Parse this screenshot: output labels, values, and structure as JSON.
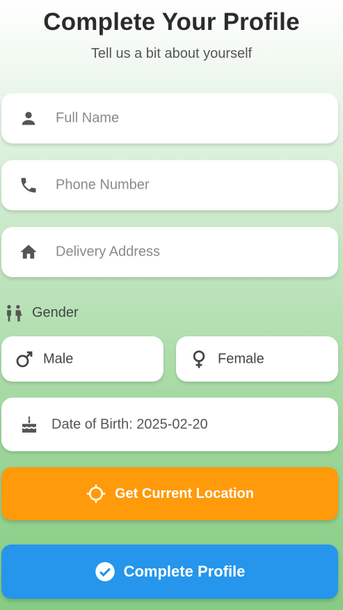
{
  "header": {
    "title": "Complete Your Profile",
    "subtitle": "Tell us a bit about yourself"
  },
  "form": {
    "full_name": {
      "placeholder": "Full Name",
      "icon": "person-icon"
    },
    "phone": {
      "placeholder": "Phone Number",
      "icon": "phone-icon"
    },
    "address": {
      "placeholder": "Delivery Address",
      "icon": "home-icon"
    },
    "gender": {
      "label": "Gender",
      "icon": "people-icon",
      "options": [
        {
          "label": "Male",
          "icon": "male-symbol-icon"
        },
        {
          "label": "Female",
          "icon": "female-symbol-icon"
        }
      ]
    },
    "dob": {
      "label": "Date of Birth: 2025-02-20",
      "icon": "cake-icon"
    }
  },
  "actions": {
    "location_label": "Get Current Location",
    "complete_label": "Complete Profile"
  },
  "colors": {
    "orange_button": "#ff9a0a",
    "blue_button": "#2596ec",
    "icon_gray": "#555555"
  }
}
